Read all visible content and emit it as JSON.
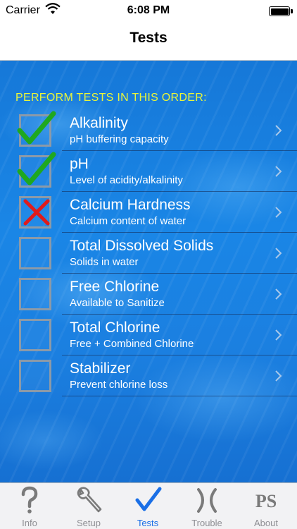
{
  "status_bar": {
    "carrier": "Carrier",
    "time": "6:08 PM"
  },
  "nav": {
    "title": "Tests"
  },
  "content": {
    "header": "PERFORM TESTS IN THIS ORDER:",
    "tests": [
      {
        "title": "Alkalinity",
        "subtitle": "pH buffering capacity",
        "status": "check"
      },
      {
        "title": "pH",
        "subtitle": "Level of acidity/alkalinity",
        "status": "check"
      },
      {
        "title": "Calcium Hardness",
        "subtitle": "Calcium content of water",
        "status": "cross"
      },
      {
        "title": "Total Dissolved Solids",
        "subtitle": "Solids in water",
        "status": "empty"
      },
      {
        "title": "Free Chlorine",
        "subtitle": "Available to Sanitize",
        "status": "empty"
      },
      {
        "title": "Total Chlorine",
        "subtitle": "Free + Combined Chlorine",
        "status": "empty"
      },
      {
        "title": "Stabilizer",
        "subtitle": "Prevent chlorine loss",
        "status": "empty"
      }
    ]
  },
  "tabs": [
    {
      "label": "Info",
      "icon": "question-icon",
      "active": false
    },
    {
      "label": "Setup",
      "icon": "wrench-icon",
      "active": false
    },
    {
      "label": "Tests",
      "icon": "checkmark-icon",
      "active": true
    },
    {
      "label": "Trouble",
      "icon": "x-icon",
      "active": false
    },
    {
      "label": "About",
      "icon": "ps-logo-icon",
      "active": false,
      "logo_text": "PS"
    }
  ],
  "colors": {
    "header_text": "#e9f53a",
    "check": "#1fa81f",
    "cross": "#e01b1b",
    "tab_active": "#1a6fe6",
    "tab_inactive": "#8e8e93"
  }
}
